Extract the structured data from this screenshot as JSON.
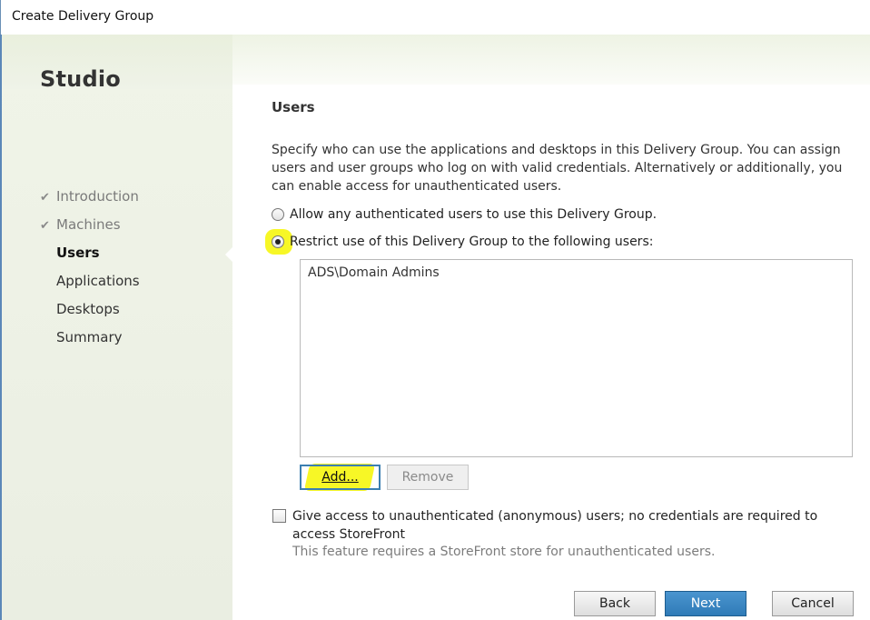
{
  "window": {
    "title": "Create Delivery Group"
  },
  "sidebar": {
    "brand": "Studio",
    "items": [
      {
        "label": "Introduction",
        "state": "done",
        "icon": "checkmark-icon"
      },
      {
        "label": "Machines",
        "state": "done",
        "icon": "checkmark-icon"
      },
      {
        "label": "Users",
        "state": "current"
      },
      {
        "label": "Applications",
        "state": "pending"
      },
      {
        "label": "Desktops",
        "state": "pending"
      },
      {
        "label": "Summary",
        "state": "pending"
      }
    ]
  },
  "main": {
    "heading": "Users",
    "description": "Specify who can use the applications and desktops in this Delivery Group. You can assign users and user groups who log on with valid credentials. Alternatively or additionally, you can enable access for unauthenticated users.",
    "options": [
      {
        "label": "Allow any authenticated users to use this Delivery Group.",
        "selected": false
      },
      {
        "label": "Restrict use of this Delivery Group to the following users:",
        "selected": true
      }
    ],
    "users": [
      "ADS\\Domain Admins"
    ],
    "add_label": "Add...",
    "remove_label": "Remove",
    "anonymous": {
      "label": "Give access to unauthenticated (anonymous) users; no credentials are required to access StoreFront",
      "checked": false,
      "note": "This feature requires a StoreFront store for unauthenticated users."
    }
  },
  "footer": {
    "back_label": "Back",
    "next_label": "Next",
    "cancel_label": "Cancel"
  },
  "colors": {
    "accent": "#2f7bb7",
    "highlight": "#f6f600"
  }
}
